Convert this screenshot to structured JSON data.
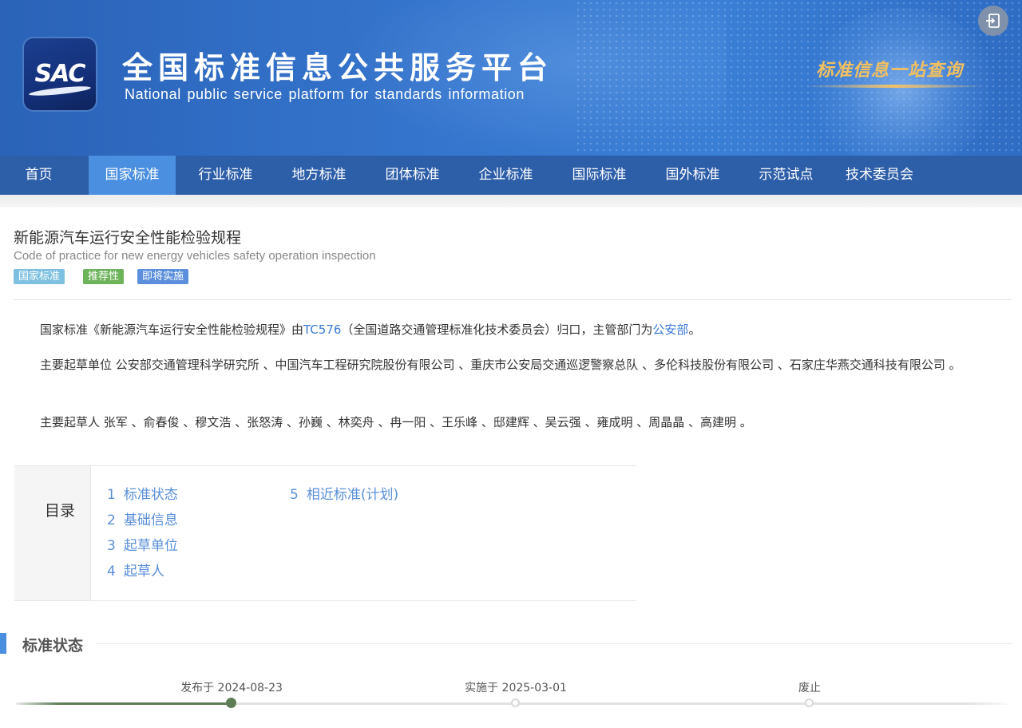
{
  "header": {
    "logo_text": "SAC",
    "title": "全国标准信息公共服务平台",
    "subtitle": "National public service platform  for standards information",
    "slogan": "标准信息一站查询",
    "login_icon": "login-icon"
  },
  "nav": {
    "items": [
      {
        "label": "首页"
      },
      {
        "label": "国家标准"
      },
      {
        "label": "行业标准"
      },
      {
        "label": "地方标准"
      },
      {
        "label": "团体标准"
      },
      {
        "label": "企业标准"
      },
      {
        "label": "国际标准"
      },
      {
        "label": "国外标准"
      },
      {
        "label": "示范试点"
      },
      {
        "label": "技术委员会"
      }
    ],
    "active": "国家标准"
  },
  "standard": {
    "title_cn": "新能源汽车运行安全性能检验规程",
    "title_en": "Code of practice for new energy vehicles safety operation inspection",
    "badges": [
      {
        "label": "国家标准",
        "color": "#7ec0e0"
      },
      {
        "label": "推荐性",
        "color": "#6db35a"
      },
      {
        "label": "即将实施",
        "color": "#5b8fdc"
      }
    ]
  },
  "summary": {
    "p1_a": "国家标准《新能源汽车运行安全性能检验规程》由",
    "p1_tc_link": "TC576",
    "p1_b": "（全国道路交通管理标准化技术委员会）归口，主管部门为",
    "p1_dept_link": "公安部",
    "p1_c": "。",
    "p2": "主要起草单位 公安部交通管理科学研究所 、中国汽车工程研究院股份有限公司 、重庆市公安局交通巡逻警察总队 、多伦科技股份有限公司 、石家庄华燕交通科技有限公司 。",
    "p3": "主要起草人 张军 、俞春俊 、穆文浩 、张怒涛 、孙巍 、林奕舟 、冉一阳 、王乐峰 、邸建辉 、吴云强 、雍成明 、周晶晶 、高建明 。"
  },
  "toc": {
    "heading": "目录",
    "items": [
      {
        "num": "1",
        "label": "标准状态"
      },
      {
        "num": "2",
        "label": "基础信息"
      },
      {
        "num": "3",
        "label": "起草单位"
      },
      {
        "num": "4",
        "label": "起草人"
      },
      {
        "num": "5",
        "label": "相近标准(计划)"
      }
    ]
  },
  "status_section": {
    "title": "标准状态",
    "timeline": [
      {
        "label": "发布于 2024-08-23",
        "done": true
      },
      {
        "label": "实施于 2025-03-01",
        "done": false
      },
      {
        "label": "废止",
        "done": false
      }
    ]
  },
  "colors": {
    "nav_bg": "#2d5ea8",
    "nav_active": "#4a8fe0",
    "link": "#3a7bd5",
    "timeline_done": "#5e7d57"
  }
}
